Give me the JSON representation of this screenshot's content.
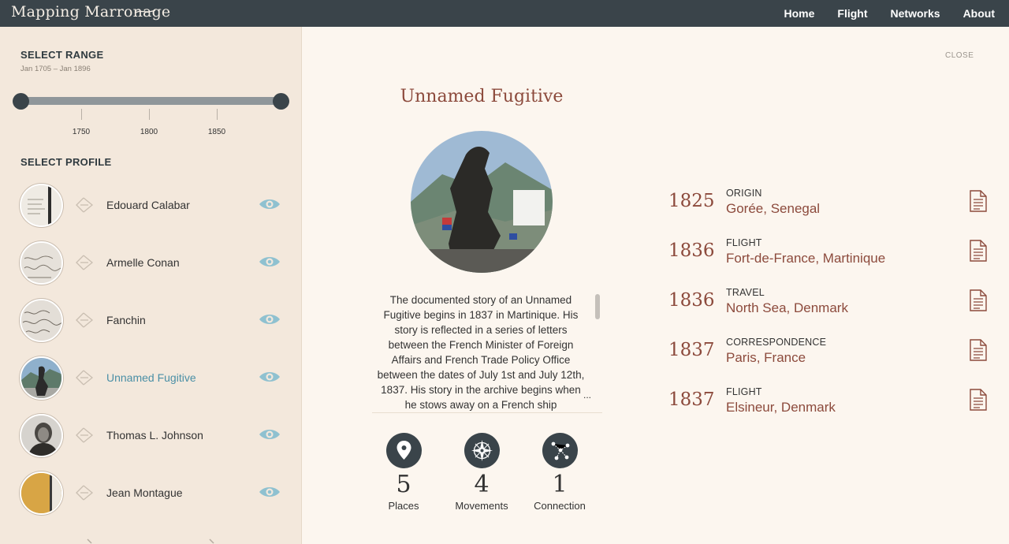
{
  "app": {
    "title": "Mapping Marronage",
    "nav": [
      "Home",
      "Flight",
      "Networks",
      "About"
    ]
  },
  "sidebar": {
    "range_title": "SELECT RANGE",
    "range_subtitle": "Jan 1705 – Jan 1896",
    "range_start": 1705,
    "range_end": 1896,
    "ticks": [
      "1750",
      "1800",
      "1850"
    ],
    "profile_title": "SELECT PROFILE",
    "profiles": [
      {
        "name": "Edouard Calabar",
        "active": false
      },
      {
        "name": "Armelle Conan",
        "active": false
      },
      {
        "name": "Fanchin",
        "active": false
      },
      {
        "name": "Unnamed Fugitive",
        "active": true
      },
      {
        "name": "Thomas L. Johnson",
        "active": false
      },
      {
        "name": "Jean Montague",
        "active": false
      }
    ]
  },
  "detail": {
    "close_label": "CLOSE",
    "title": "Unnamed Fugitive",
    "story": "The documented story of an Unnamed Fugitive begins in 1837 in Martinique. His story is reflected in a series of letters between the French Minister of Foreign Affairs and French Trade Policy Office between the dates of July 1st and July 12th, 1837. His story in the archive begins when he stows away on a French ship",
    "ellipsis": "...",
    "stats": [
      {
        "value": "5",
        "label": "Places",
        "icon": "map-pin-icon"
      },
      {
        "value": "4",
        "label": "Movements",
        "icon": "compass-icon"
      },
      {
        "value": "1",
        "label": "Connection",
        "icon": "network-icon"
      }
    ],
    "timeline": [
      {
        "year": "1825",
        "type": "ORIGIN",
        "place": "Gorée, Senegal"
      },
      {
        "year": "1836",
        "type": "FLIGHT",
        "place": "Fort-de-France, Martinique"
      },
      {
        "year": "1836",
        "type": "TRAVEL",
        "place": "North Sea, Denmark"
      },
      {
        "year": "1837",
        "type": "CORRESPONDENCE",
        "place": "Paris, France"
      },
      {
        "year": "1837",
        "type": "FLIGHT",
        "place": "Elsineur, Denmark"
      }
    ]
  },
  "colors": {
    "topbar": "#3a444a",
    "sidebar_bg": "#f3e8dc",
    "main_bg": "#fcf6ef",
    "accent_red": "#8c4a3c",
    "accent_blue": "#4a8fa6",
    "eye_blue": "#8fc1d0"
  }
}
